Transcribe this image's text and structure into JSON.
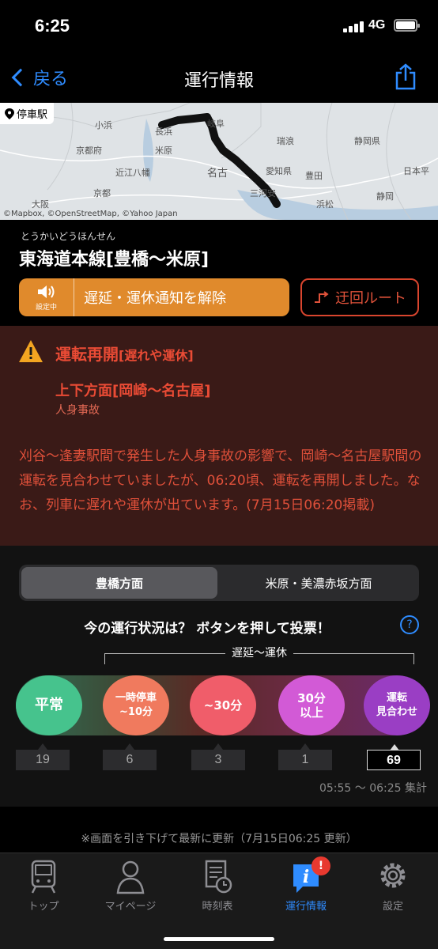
{
  "status_bar": {
    "time": "6:25",
    "network": "4G"
  },
  "nav": {
    "back_label": "戻る",
    "title": "運行情報"
  },
  "map": {
    "badge": "停車駅",
    "credit": "©Mapbox, ©OpenStreetMap, ©Yahoo Japan",
    "labels": [
      "小浜",
      "京都府",
      "長浜",
      "米原",
      "近江八幡",
      "京都",
      "岐阜",
      "瑞浪",
      "名古",
      "愛知県",
      "三河安",
      "豊田",
      "静岡県",
      "静岡",
      "浜松",
      "日本平",
      "大阪"
    ]
  },
  "line": {
    "kana": "とうかいどうほんせん",
    "name": "東海道本線[豊橋〜米原]"
  },
  "buttons": {
    "notify_status": "設定中",
    "notify_label": "遅延・運休通知を解除",
    "detour_label": "迂回ルート"
  },
  "alert": {
    "title": "運転再開",
    "subtitle": "[遅れや運休]",
    "direction": "上下方面[岡崎〜名古屋]",
    "cause": "人身事故",
    "body": "刈谷〜逢妻駅間で発生した人身事故の影響で、岡崎〜名古屋駅間の運転を見合わせていましたが、06:20頃、運転を再開しました。なお、列車に遅れや運休が出ています。(7月15日06:20掲載)"
  },
  "vote": {
    "tabs": [
      "豊橋方面",
      "米原・美濃赤坂方面"
    ],
    "question": "今の運行状況は？ ボタンを押して投票！",
    "help": "?",
    "range_label": "遅延〜運休",
    "options": [
      {
        "line1": "平常",
        "line2": "",
        "count": "19"
      },
      {
        "line1": "一時停車",
        "line2": "~10分",
        "count": "6"
      },
      {
        "line1": "~30分",
        "line2": "",
        "count": "3"
      },
      {
        "line1": "30分",
        "line2": "以上",
        "count": "1"
      },
      {
        "line1": "運転",
        "line2": "見合わせ",
        "count": "69"
      }
    ],
    "tally_period": "05:55 〜 06:25 集計"
  },
  "refresh_note": "※画面を引き下げて最新に更新（7月15日06:25 更新）",
  "tabbar": {
    "items": [
      "トップ",
      "マイページ",
      "時刻表",
      "運行情報",
      "設定"
    ],
    "badge": "!"
  },
  "colors": {
    "accent": "#2f8cff",
    "alert": "#ea4b35",
    "notify": "#e08a2c"
  }
}
